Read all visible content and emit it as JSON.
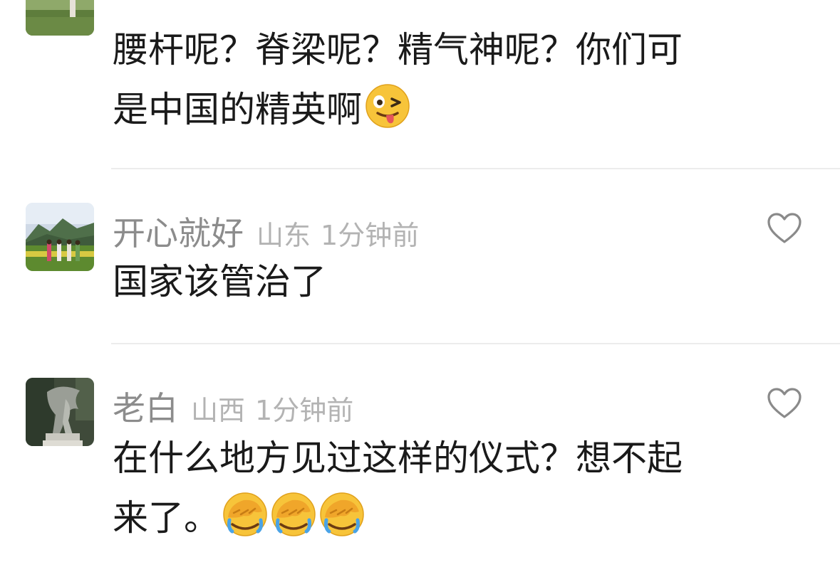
{
  "comments": [
    {
      "text_line1": "腰杆呢？脊梁呢？精气神呢？你们可",
      "text_line2": "是中国的精英啊",
      "emoji": "winking-tongue-face-icon"
    },
    {
      "username": "开心就好",
      "location": "山东",
      "time": "1分钟前",
      "text_line1": "国家该管治了",
      "avatar": "landscape-photo-avatar"
    },
    {
      "username": "老白",
      "location": "山西",
      "time": "1分钟前",
      "text_line1": "在什么地方见过这样的仪式？想不起",
      "text_line2": "来了。",
      "emoji": "facepalm-face-icon",
      "emoji_count": 3,
      "avatar": "statue-photo-avatar"
    }
  ],
  "colors": {
    "username": "#8c8c8c",
    "meta": "#b3b3b3",
    "text": "#1a1a1a",
    "divider": "#ececec",
    "like_outline": "#8a8a8a",
    "emoji_yellow": "#f7c43a"
  }
}
